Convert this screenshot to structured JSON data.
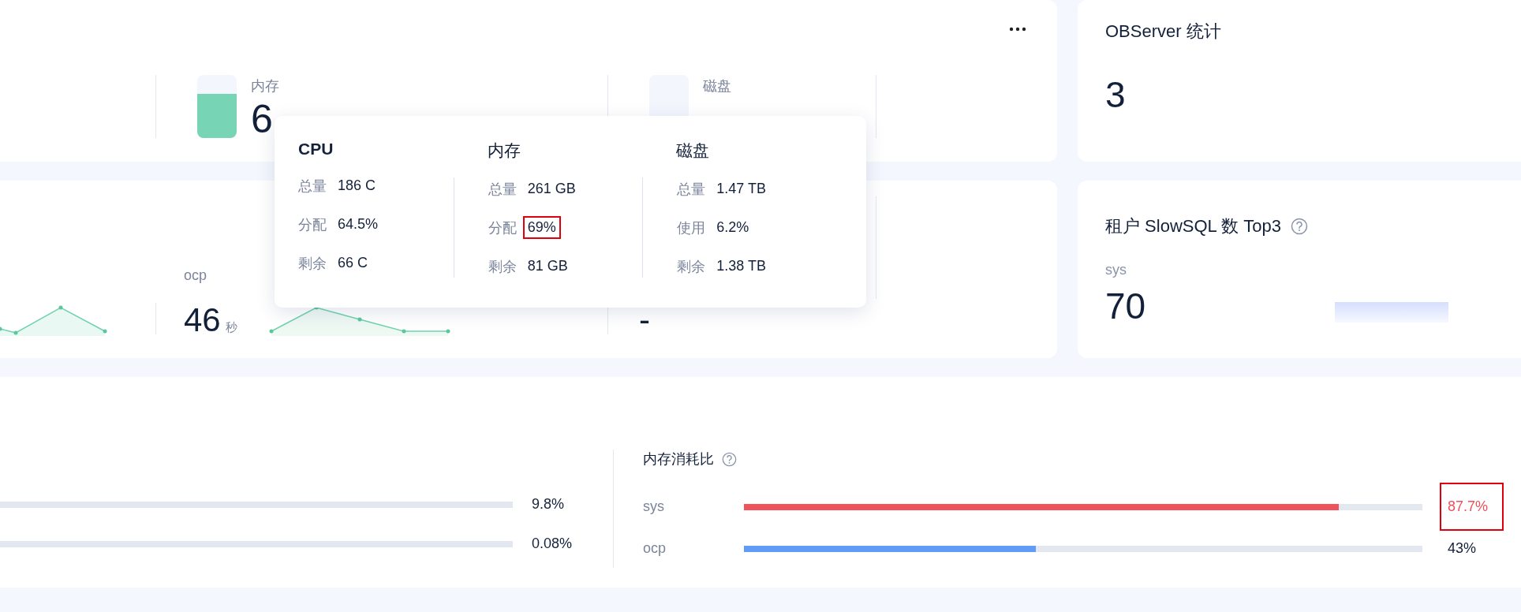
{
  "resource_card": {
    "metrics": [
      {
        "kind": "tank",
        "label": "内存",
        "value": "6",
        "level": 0.7
      },
      {
        "kind": "tank",
        "label": "磁盘"
      }
    ]
  },
  "trend_card": {
    "sections": [
      {
        "kind": "sparkline"
      },
      {
        "kind": "stat",
        "label": "ocp",
        "value": "46",
        "unit": "秒"
      },
      {
        "kind": "stat",
        "value": "-"
      }
    ]
  },
  "tooltip": {
    "columns": [
      {
        "title": "CPU",
        "rows": [
          {
            "label": "总量",
            "value": "186 C",
            "highlighted": false
          },
          {
            "label": "分配",
            "value": "64.5%",
            "highlighted": false
          },
          {
            "label": "剩余",
            "value": "66 C",
            "highlighted": false
          }
        ]
      },
      {
        "title": "内存",
        "rows": [
          {
            "label": "总量",
            "value": "261 GB",
            "highlighted": false
          },
          {
            "label": "分配",
            "value": "69%",
            "highlighted": true
          },
          {
            "label": "剩余",
            "value": "81 GB",
            "highlighted": false
          }
        ]
      },
      {
        "title": "磁盘",
        "rows": [
          {
            "label": "总量",
            "value": "1.47 TB",
            "highlighted": false
          },
          {
            "label": "使用",
            "value": "6.2%",
            "highlighted": false
          },
          {
            "label": "剩余",
            "value": "1.38 TB",
            "highlighted": false
          }
        ]
      }
    ]
  },
  "observer_card": {
    "title": "OBServer 统计",
    "value": "3"
  },
  "slowsql_card": {
    "title": "租户 SlowSQL 数 Top3",
    "tenant": "sys",
    "value": "70"
  },
  "usage_card": {
    "left_rows": [
      {
        "value": "9.8%"
      },
      {
        "value": "0.08%"
      }
    ],
    "memory": {
      "title": "内存消耗比",
      "rows": [
        {
          "name": "sys",
          "level": 0.877,
          "value": "87.7%",
          "color": "#f0515a",
          "warning": true,
          "highlighted": true
        },
        {
          "name": "ocp",
          "level": 0.43,
          "value": "43%",
          "color": "#5f9bf7",
          "warning": false,
          "highlighted": false
        }
      ]
    }
  }
}
